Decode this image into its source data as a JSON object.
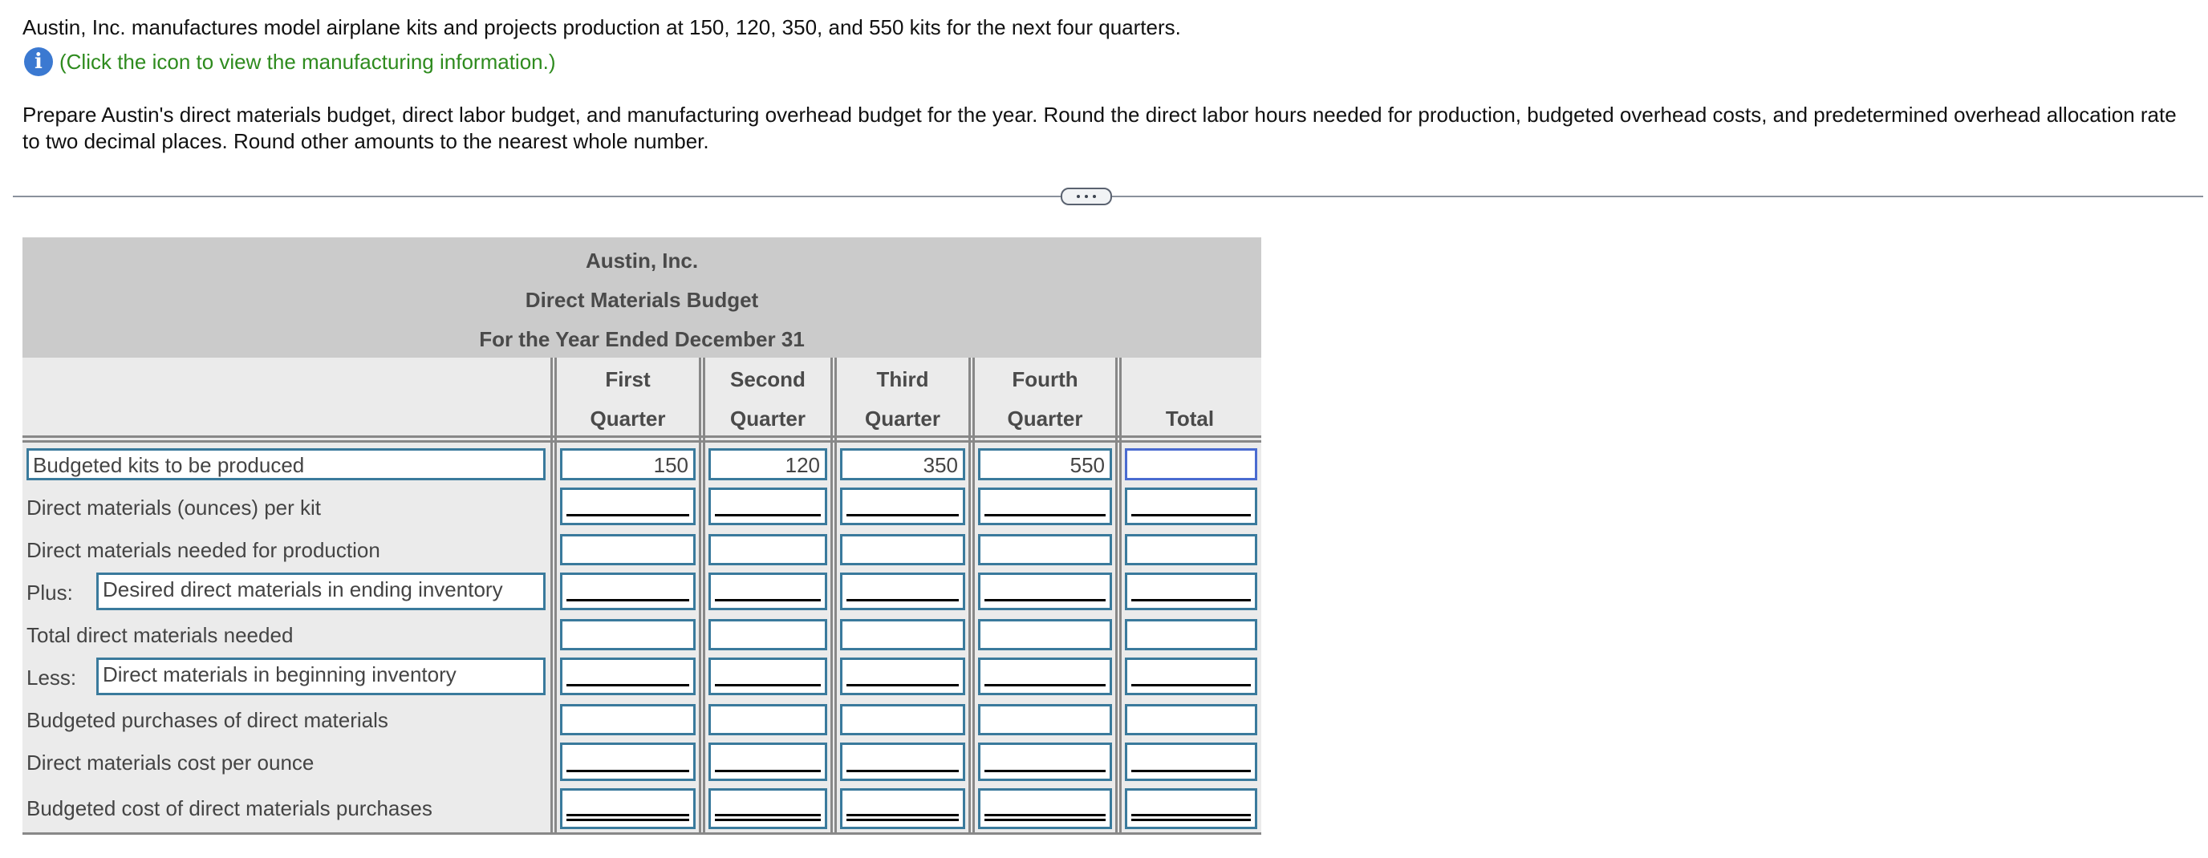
{
  "intro": {
    "problem_text": "Austin, Inc. manufactures model airplane kits and projects production at 150, 120, 350, and 550 kits for the next four quarters.",
    "info_icon": "info-icon",
    "info_link": "(Click the icon to view the manufacturing information.)",
    "instructions": "Prepare Austin's direct materials budget, direct labor budget, and manufacturing overhead budget for the year. Round the direct labor hours needed for production, budgeted overhead costs, and predetermined overhead allocation rate to two decimal places. Round other amounts to the nearest whole number."
  },
  "separator": {
    "expand_icon": "more-dots-icon"
  },
  "table": {
    "company": "Austin, Inc.",
    "title": "Direct Materials Budget",
    "period": "For the Year Ended December 31",
    "columns": [
      {
        "line1": "First",
        "line2": "Quarter"
      },
      {
        "line1": "Second",
        "line2": "Quarter"
      },
      {
        "line1": "Third",
        "line2": "Quarter"
      },
      {
        "line1": "Fourth",
        "line2": "Quarter"
      },
      {
        "line1": "",
        "line2": "Total"
      }
    ],
    "rows": [
      {
        "prefix": "",
        "label": "Budgeted kits to be produced",
        "label_is_input": true,
        "values": [
          "150",
          "120",
          "350",
          "550",
          ""
        ],
        "underline": "none"
      },
      {
        "prefix": "",
        "label": "Direct materials (ounces) per kit",
        "label_is_input": false,
        "values": [
          "",
          "",
          "",
          "",
          ""
        ],
        "underline": "single"
      },
      {
        "prefix": "",
        "label": "Direct materials needed for production",
        "label_is_input": false,
        "values": [
          "",
          "",
          "",
          "",
          ""
        ],
        "underline": "none"
      },
      {
        "prefix": "Plus:",
        "label": "Desired direct materials in ending inventory",
        "label_is_input": true,
        "values": [
          "",
          "",
          "",
          "",
          ""
        ],
        "underline": "single"
      },
      {
        "prefix": "",
        "label": "Total direct materials needed",
        "label_is_input": false,
        "values": [
          "",
          "",
          "",
          "",
          ""
        ],
        "underline": "none"
      },
      {
        "prefix": "Less:",
        "label": "Direct materials in beginning inventory",
        "label_is_input": true,
        "values": [
          "",
          "",
          "",
          "",
          ""
        ],
        "underline": "single"
      },
      {
        "prefix": "",
        "label": "Budgeted purchases of direct materials",
        "label_is_input": false,
        "values": [
          "",
          "",
          "",
          "",
          ""
        ],
        "underline": "none"
      },
      {
        "prefix": "",
        "label": "Direct materials cost per ounce",
        "label_is_input": false,
        "values": [
          "",
          "",
          "",
          "",
          ""
        ],
        "underline": "single"
      },
      {
        "prefix": "",
        "label": "Budgeted cost of direct materials purchases",
        "label_is_input": false,
        "values": [
          "",
          "",
          "",
          "",
          ""
        ],
        "underline": "double"
      }
    ],
    "focused_cell": {
      "row": 0,
      "col": 4
    }
  },
  "colors": {
    "input_border": "#3a7a9c",
    "focused_border": "#4a6bd0",
    "info_link": "#2e8b1e",
    "info_icon": "#3b79d1",
    "title_band": "#cbcbcb",
    "table_bg": "#ebebeb"
  }
}
